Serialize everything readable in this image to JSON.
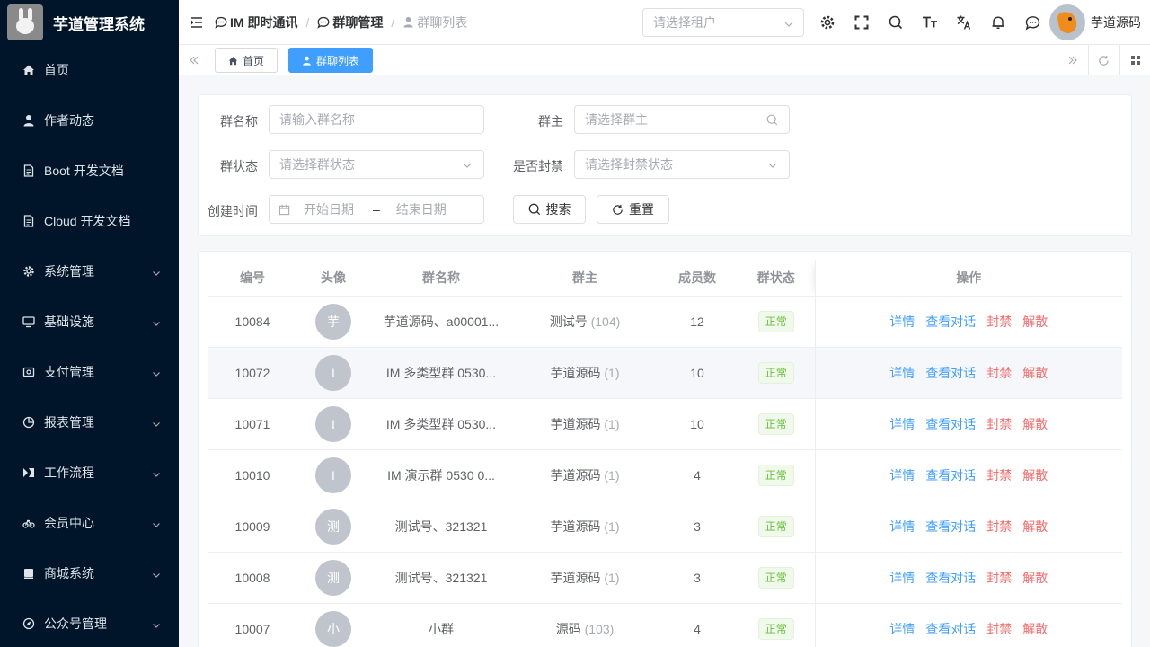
{
  "app": {
    "title": "芋道管理系统"
  },
  "sidebar": {
    "items": [
      {
        "label": "首页",
        "icon": "home-icon",
        "submenu": false
      },
      {
        "label": "作者动态",
        "icon": "user-icon",
        "submenu": false
      },
      {
        "label": "Boot 开发文档",
        "icon": "document-icon",
        "submenu": false
      },
      {
        "label": "Cloud 开发文档",
        "icon": "document-icon",
        "submenu": false
      },
      {
        "label": "系统管理",
        "icon": "gear-icon",
        "submenu": true
      },
      {
        "label": "基础设施",
        "icon": "monitor-icon",
        "submenu": true
      },
      {
        "label": "支付管理",
        "icon": "wallet-icon",
        "submenu": true
      },
      {
        "label": "报表管理",
        "icon": "pie-chart-icon",
        "submenu": true
      },
      {
        "label": "工作流程",
        "icon": "workflow-icon",
        "submenu": true
      },
      {
        "label": "会员中心",
        "icon": "bicycle-icon",
        "submenu": true
      },
      {
        "label": "商城系统",
        "icon": "shop-icon",
        "submenu": true
      },
      {
        "label": "公众号管理",
        "icon": "compass-icon",
        "submenu": true
      }
    ]
  },
  "header": {
    "breadcrumbs": [
      "IM 即时通讯",
      "群聊管理",
      "群聊列表"
    ],
    "tenant_placeholder": "请选择租户",
    "username": "芋道源码"
  },
  "tags": {
    "home": "首页",
    "active": "群聊列表"
  },
  "search": {
    "group_name_label": "群名称",
    "group_name_placeholder": "请输入群名称",
    "owner_label": "群主",
    "owner_placeholder": "请选择群主",
    "status_label": "群状态",
    "status_placeholder": "请选择群状态",
    "banned_label": "是否封禁",
    "banned_placeholder": "请选择封禁状态",
    "created_label": "创建时间",
    "start_placeholder": "开始日期",
    "range_sep": "–",
    "end_placeholder": "结束日期",
    "search_button": "搜索",
    "reset_button": "重置"
  },
  "table": {
    "headers": {
      "id": "编号",
      "avatar": "头像",
      "name": "群名称",
      "owner": "群主",
      "members": "成员数",
      "status": "群状态",
      "actions": "操作"
    },
    "actions": {
      "detail": "详情",
      "chat": "查看对话",
      "ban": "封禁",
      "dissolve": "解散"
    },
    "rows": [
      {
        "id": "10084",
        "avatar": "芋",
        "name": "芋道源码、a00001...",
        "owner": "测试号",
        "owner_count": "(104)",
        "members": "12",
        "status": "正常"
      },
      {
        "id": "10072",
        "avatar": "I",
        "name": "IM 多类型群 0530...",
        "owner": "芋道源码",
        "owner_count": "(1)",
        "members": "10",
        "status": "正常"
      },
      {
        "id": "10071",
        "avatar": "I",
        "name": "IM 多类型群 0530...",
        "owner": "芋道源码",
        "owner_count": "(1)",
        "members": "10",
        "status": "正常"
      },
      {
        "id": "10010",
        "avatar": "I",
        "name": "IM 演示群 0530 0...",
        "owner": "芋道源码",
        "owner_count": "(1)",
        "members": "4",
        "status": "正常"
      },
      {
        "id": "10009",
        "avatar": "测",
        "name": "测试号、321321",
        "owner": "芋道源码",
        "owner_count": "(1)",
        "members": "3",
        "status": "正常"
      },
      {
        "id": "10008",
        "avatar": "测",
        "name": "测试号、321321",
        "owner": "芋道源码",
        "owner_count": "(1)",
        "members": "3",
        "status": "正常"
      },
      {
        "id": "10007",
        "avatar": "小",
        "name": "小群",
        "owner": "源码",
        "owner_count": "(103)",
        "members": "4",
        "status": "正常"
      }
    ]
  },
  "colors": {
    "sidebar_bg": "#001529",
    "primary": "#409eff",
    "danger": "#f56c6c",
    "success": "#67c23a"
  }
}
